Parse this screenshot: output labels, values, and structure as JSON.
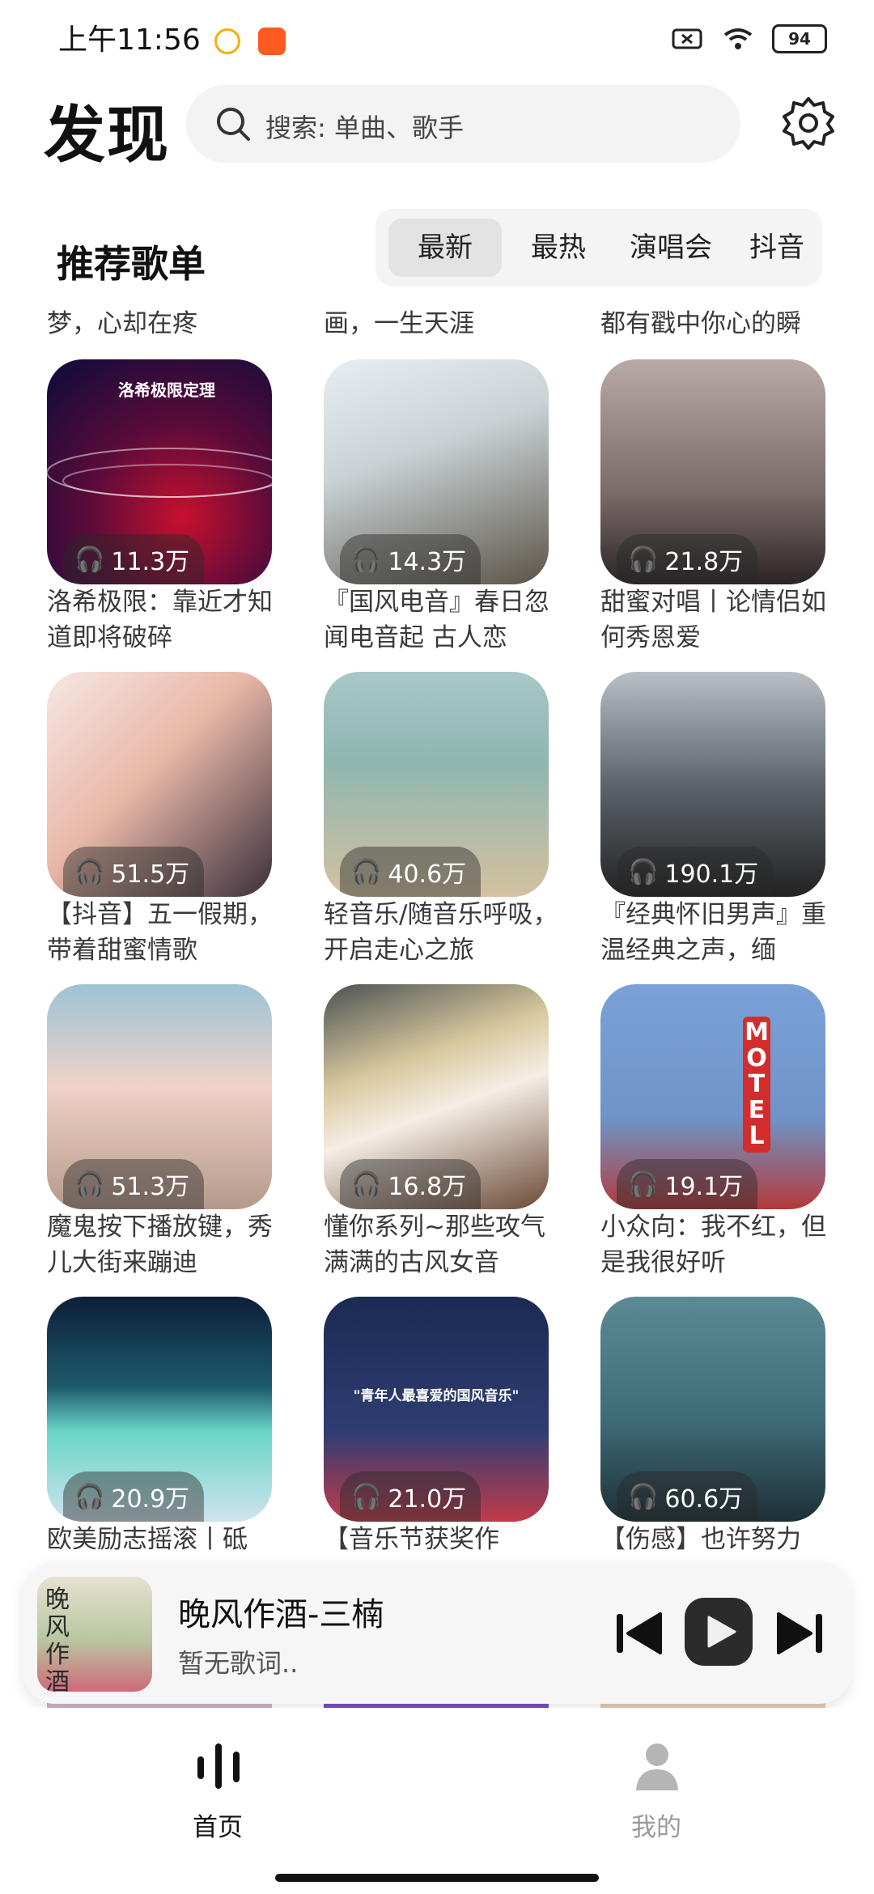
{
  "status": {
    "time": "上午11:56",
    "battery": "94"
  },
  "header": {
    "title": "发现",
    "search_placeholder": "搜索: 单曲、歌手"
  },
  "section": {
    "title": "推荐歌单"
  },
  "tabs": [
    {
      "label": "最新",
      "selected": true
    },
    {
      "label": "最热",
      "selected": false
    },
    {
      "label": "演唱会",
      "selected": false
    },
    {
      "label": "抖音",
      "selected": false
    }
  ],
  "partial_top_titles": [
    "梦，心却在疼",
    "画，一生天涯",
    "都有戳中你心的瞬"
  ],
  "playlists": [
    {
      "count": "11.3万",
      "title": "洛希极限：靠近才知道即将破碎",
      "cover_text": "洛希极限定理"
    },
    {
      "count": "14.3万",
      "title": "『国风电音』春日忽闻电音起 古人恋"
    },
    {
      "count": "21.8万",
      "title": "甜蜜对唱丨论情侣如何秀恩爱"
    },
    {
      "count": "51.5万",
      "title": "【抖音】五一假期，带着甜蜜情歌"
    },
    {
      "count": "40.6万",
      "title": "轻音乐/随音乐呼吸，开启走心之旅"
    },
    {
      "count": "190.1万",
      "title": "『经典怀旧男声』重温经典之声，缅"
    },
    {
      "count": "51.3万",
      "title": "魔鬼按下播放键，秀儿大街来蹦迪"
    },
    {
      "count": "16.8万",
      "title": "懂你系列~那些攻气满满的古风女音"
    },
    {
      "count": "19.1万",
      "title": "小众向：我不红，但是我很好听",
      "cover_text": "MOTEL"
    },
    {
      "count": "20.9万",
      "title": "欧美励志摇滚丨砥"
    },
    {
      "count": "21.0万",
      "title": "【音乐节获奖作",
      "cover_text": "\"青年人最喜爱的国风音乐\""
    },
    {
      "count": "60.6万",
      "title": "【伤感】也许努力"
    }
  ],
  "player": {
    "song": "晚风作酒-三楠",
    "lyric": "暂无歌词..",
    "cover_text": "晚风作酒"
  },
  "nav": {
    "home": "首页",
    "mine": "我的"
  },
  "colors": {
    "accent": "#111111",
    "inactive": "#9a9a9a"
  }
}
